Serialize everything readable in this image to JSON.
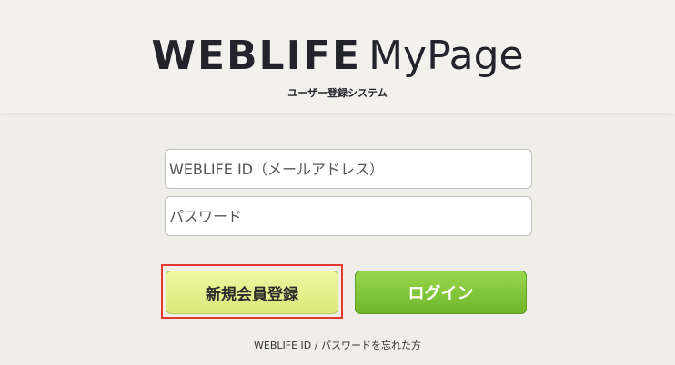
{
  "header": {
    "logo_strong": "WEBLIFE",
    "logo_light": "MyPage",
    "subtitle": "ユーザー登録システム"
  },
  "form": {
    "id_placeholder": "WEBLIFE ID（メールアドレス）",
    "password_placeholder": "パスワード"
  },
  "actions": {
    "register_label": "新規会員登録",
    "login_label": "ログイン",
    "forgot_label": "WEBLIFE ID / パスワードを忘れた方"
  },
  "colors": {
    "register_button": "#e4f08c",
    "login_button": "#7cc236",
    "highlight_border": "#e33a2e",
    "logo_text": "#23242b"
  }
}
